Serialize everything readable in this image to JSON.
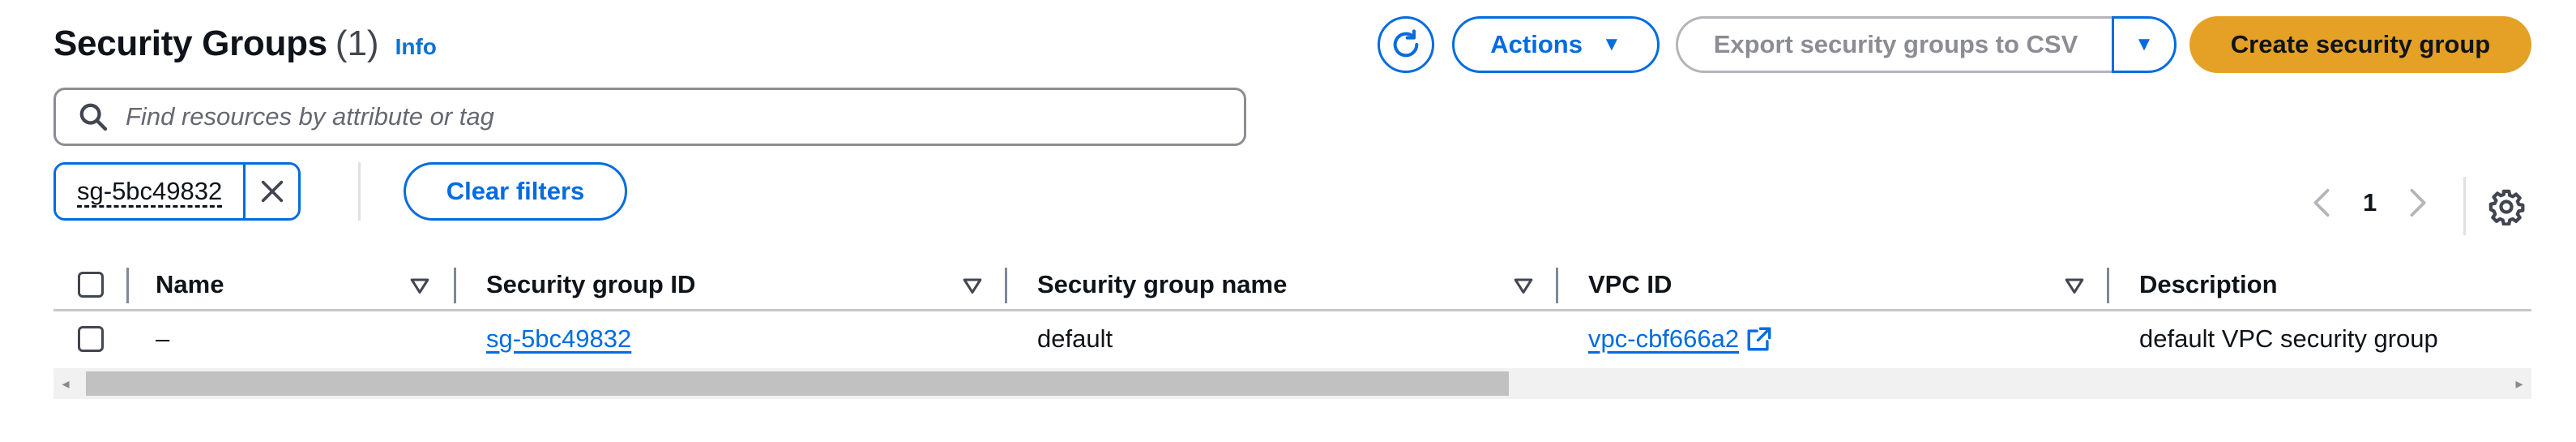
{
  "header": {
    "title": "Security Groups",
    "count": "(1)",
    "info": "Info"
  },
  "toolbar": {
    "actions_label": "Actions",
    "export_label": "Export security groups to CSV",
    "create_label": "Create security group"
  },
  "search": {
    "placeholder": "Find resources by attribute or tag",
    "value": ""
  },
  "filter": {
    "token": "sg-5bc49832",
    "clear_label": "Clear filters"
  },
  "pagination": {
    "current_page": "1"
  },
  "table": {
    "columns": [
      "Name",
      "Security group ID",
      "Security group name",
      "VPC ID",
      "Description"
    ],
    "rows": [
      {
        "name": "–",
        "security_group_id": "sg-5bc49832",
        "security_group_name": "default",
        "vpc_id": "vpc-cbf666a2",
        "description": "default VPC security group"
      }
    ]
  },
  "colors": {
    "primary": "#006ce0",
    "cta": "#e5a125",
    "disabled": "#8c8c94"
  }
}
